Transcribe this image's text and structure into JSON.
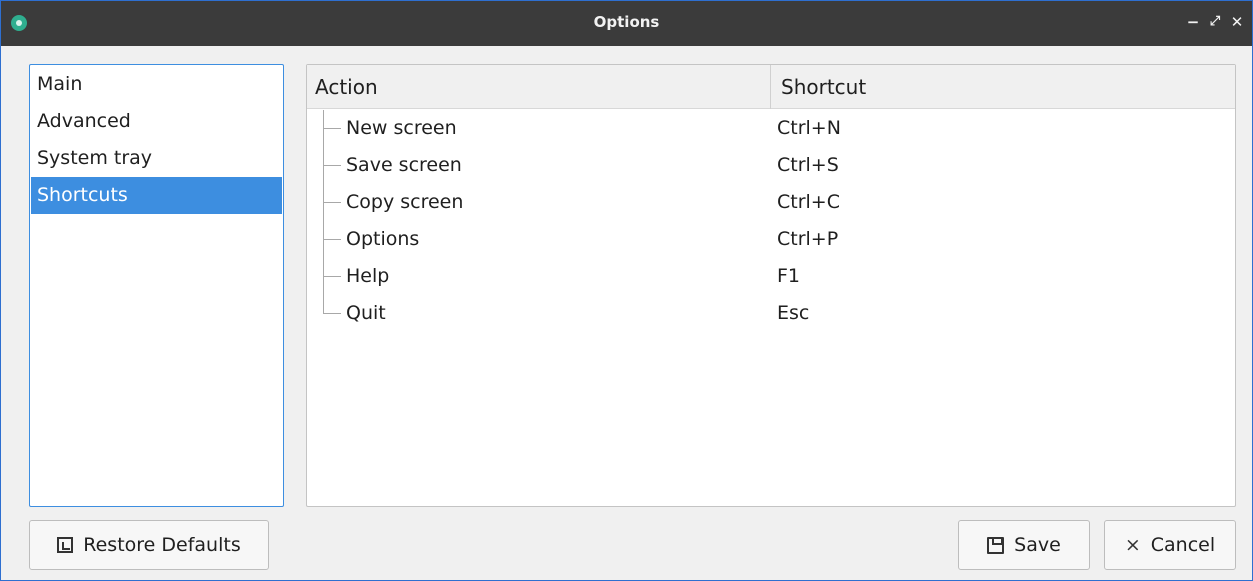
{
  "window": {
    "title": "Options",
    "controls": {
      "minimize": "−",
      "maximize": "⤢",
      "close": "✕"
    }
  },
  "sidebar": {
    "items": [
      {
        "label": "Main",
        "selected": false
      },
      {
        "label": "Advanced",
        "selected": false
      },
      {
        "label": "System tray",
        "selected": false
      },
      {
        "label": "Shortcuts",
        "selected": true
      }
    ]
  },
  "table": {
    "headers": {
      "action": "Action",
      "shortcut": "Shortcut"
    },
    "rows": [
      {
        "action": "New screen",
        "shortcut": "Ctrl+N"
      },
      {
        "action": "Save screen",
        "shortcut": "Ctrl+S"
      },
      {
        "action": "Copy screen",
        "shortcut": "Ctrl+C"
      },
      {
        "action": "Options",
        "shortcut": "Ctrl+P"
      },
      {
        "action": "Help",
        "shortcut": "F1"
      },
      {
        "action": "Quit",
        "shortcut": "Esc"
      }
    ]
  },
  "buttons": {
    "restore_label": "Restore Defaults",
    "save_label": "Save",
    "cancel_label": "Cancel",
    "cancel_icon": "×"
  },
  "icons": {
    "app": "app-icon",
    "restore": "restore-icon",
    "save": "save-icon",
    "cancel": "cancel-icon"
  },
  "colors": {
    "titlebar": "#3b3b3b",
    "accent": "#3d8ee0",
    "window_bg": "#f0f0f0"
  }
}
